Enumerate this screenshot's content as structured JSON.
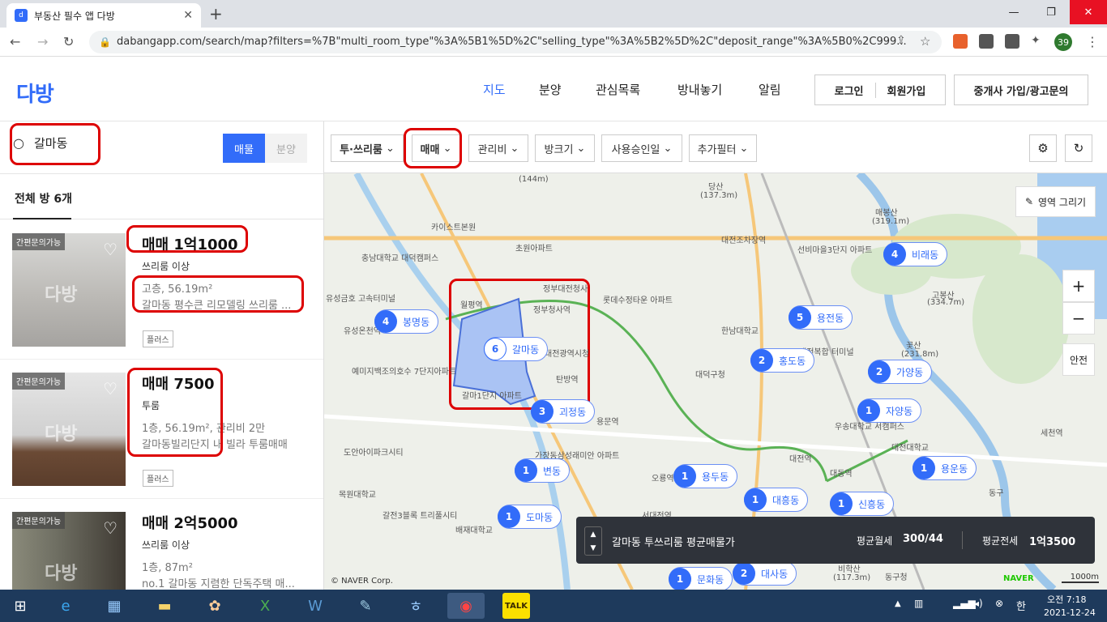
{
  "browser": {
    "tab_title": "부동산 필수 앱 다방",
    "url": "dabangapp.com/search/map?filters=%7B\"multi_room_type\"%3A%5B1%5D%2C\"selling_type\"%3A%5B2%5D%2C\"deposit_range\"%3A%5B0%2C999...",
    "profile_badge": "39"
  },
  "header": {
    "logo": "다방",
    "menu": [
      "지도",
      "분양",
      "관심목록",
      "방내놓기",
      "알림"
    ],
    "login": "로그인",
    "signup": "회원가입",
    "agent": "중개사 가입/광고문의"
  },
  "sidebar": {
    "search_value": "갈마동",
    "toggle_on": "매물",
    "toggle_off": "분양",
    "count_label": "전체 방 6개",
    "items": [
      {
        "tag": "간편문의가능",
        "price": "매매 1억1000",
        "type": "쓰리룸 이상",
        "line1": "고층, 56.19m²",
        "line2": "갈마동 평수큰 리모델링 쓰리룸 ...",
        "badge": "플러스",
        "wm": "다방"
      },
      {
        "tag": "간편문의가능",
        "price": "매매 7500",
        "type": "투룸",
        "line1": "1층, 56.19m², 관리비 2만",
        "line2": "갈마동빌리단지 내 빌라 투룸매매",
        "badge": "플러스",
        "wm": "다방"
      },
      {
        "tag": "간편문의가능",
        "price": "매매 2억5000",
        "type": "쓰리룸 이상",
        "line1": "1층, 87m²",
        "line2": "no.1 갈마동 지렴한 단독주택 매...",
        "badge": "",
        "wm": "다방"
      }
    ]
  },
  "filters": {
    "room_type": "투·쓰리룸",
    "deal_type": "매매",
    "fee": "관리비",
    "size": "방크기",
    "approval": "사용승인일",
    "more": "추가필터"
  },
  "map": {
    "draw_area": "영역 그리기",
    "safety": "안전",
    "copyright": "© NAVER Corp.",
    "naver": "NAVER",
    "scale": "1000m",
    "pins": [
      {
        "count": "6",
        "name": "갈마동"
      },
      {
        "count": "4",
        "name": "봉명동"
      },
      {
        "count": "4",
        "name": "비래동"
      },
      {
        "count": "5",
        "name": "용전동"
      },
      {
        "count": "2",
        "name": "홍도동"
      },
      {
        "count": "2",
        "name": "가양동"
      },
      {
        "count": "1",
        "name": "자양동"
      },
      {
        "count": "3",
        "name": "괴정동"
      },
      {
        "count": "1",
        "name": "변동"
      },
      {
        "count": "1",
        "name": "용두동"
      },
      {
        "count": "1",
        "name": "대흥동"
      },
      {
        "count": "1",
        "name": "신흥동"
      },
      {
        "count": "1",
        "name": "용운동"
      },
      {
        "count": "1",
        "name": "도마동"
      },
      {
        "count": "1",
        "name": "문화동"
      },
      {
        "count": "2",
        "name": "대사동"
      }
    ],
    "labels": [
      "(144m)",
      "당산",
      "(137.3m)",
      "카이스트본원",
      "충남대학교 대덕캠퍼스",
      "초원아파트",
      "대전조차장역",
      "선비마을3단지 아파트",
      "매봉산",
      "(319.1m)",
      "정부대전청사",
      "정부청사역",
      "롯데수정타운 아파트",
      "월평역",
      "한남대학교",
      "고봉산",
      "(334.7m)",
      "대전광역시청",
      "탄방역",
      "대덕구청",
      "대전복합 터미널",
      "꽃산",
      "(231.8m)",
      "예미지백조의호수 7단지아파트",
      "갈마1단지 아파트",
      "가장동삼성래미안 아파트",
      "용문역",
      "우송대학교 서캠퍼스",
      "대전대학교",
      "도안아이파크시티",
      "목원대학교",
      "갈전3블록 트리풀시티",
      "배재대학교",
      "오룡역",
      "대전역",
      "대동역",
      "세천역",
      "동구",
      "비학산",
      "(117.3m)",
      "서대전역",
      "유성온천역",
      "유성금호 고속터미널",
      "동구청"
    ]
  },
  "summary": {
    "title": "갈마동 투쓰리룸 평균매물가",
    "monthly_label": "평균월세",
    "monthly_value": "300/44",
    "jeonse_label": "평균전세",
    "jeonse_value": "1억3500"
  },
  "taskbar": {
    "time": "오전 7:18",
    "date": "2021-12-24",
    "ime": "한"
  }
}
